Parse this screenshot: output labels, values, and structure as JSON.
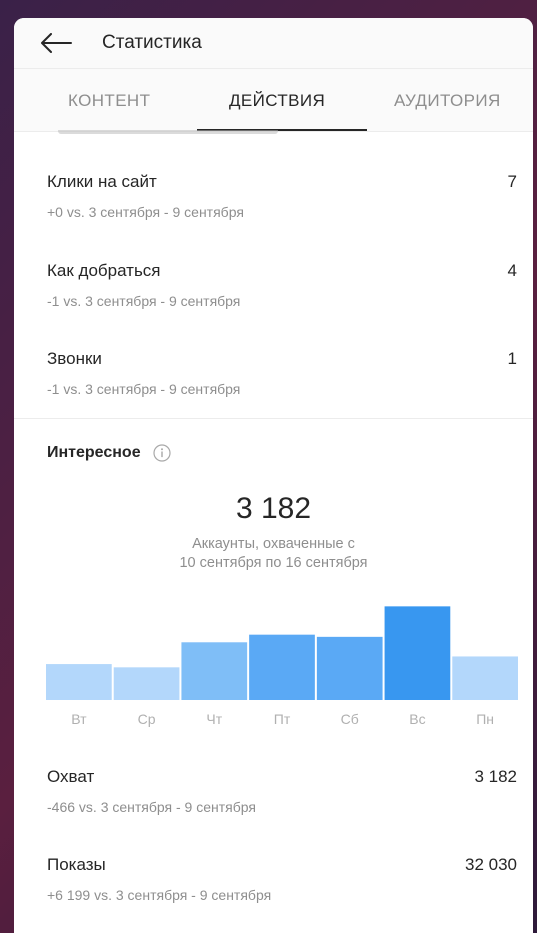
{
  "header": {
    "title": "Статистика"
  },
  "tabs": [
    {
      "label": "КОНТЕНТ",
      "active": false
    },
    {
      "label": "ДЕЙСТВИЯ",
      "active": true
    },
    {
      "label": "АУДИТОРИЯ",
      "active": false
    }
  ],
  "actions": [
    {
      "label": "Клики на сайт",
      "value": "7",
      "sub": "+0 vs. 3 сентября - 9 сентября"
    },
    {
      "label": "Как добраться",
      "value": "4",
      "sub": "-1 vs. 3 сентября - 9 сентября"
    },
    {
      "label": "Звонки",
      "value": "1",
      "sub": "-1 vs. 3 сентября - 9 сентября"
    }
  ],
  "discovery": {
    "title": "Интересное",
    "total": "3 182",
    "caption_line1": "Аккаунты, охваченные с",
    "caption_line2": "10 сентября по 16 сентября"
  },
  "chart_data": {
    "type": "bar",
    "categories": [
      "Вт",
      "Ср",
      "Чт",
      "Пт",
      "Сб",
      "Вс",
      "Пн"
    ],
    "values": [
      33,
      30,
      53,
      60,
      58,
      86,
      40
    ],
    "highlight_index": 5,
    "colors": {
      "normal_light": "#b3d7fb",
      "normal_mid": "#7fbef7",
      "normal_dark": "#5aa9f5",
      "highlight": "#3897f0"
    },
    "ylim": [
      0,
      90
    ],
    "title": "",
    "xlabel": "",
    "ylabel": ""
  },
  "metrics": [
    {
      "label": "Охват",
      "value": "3 182",
      "sub": "-466 vs. 3 сентября - 9 сентября"
    },
    {
      "label": "Показы",
      "value": "32 030",
      "sub": "+6 199 vs. 3 сентября - 9 сентября"
    }
  ]
}
